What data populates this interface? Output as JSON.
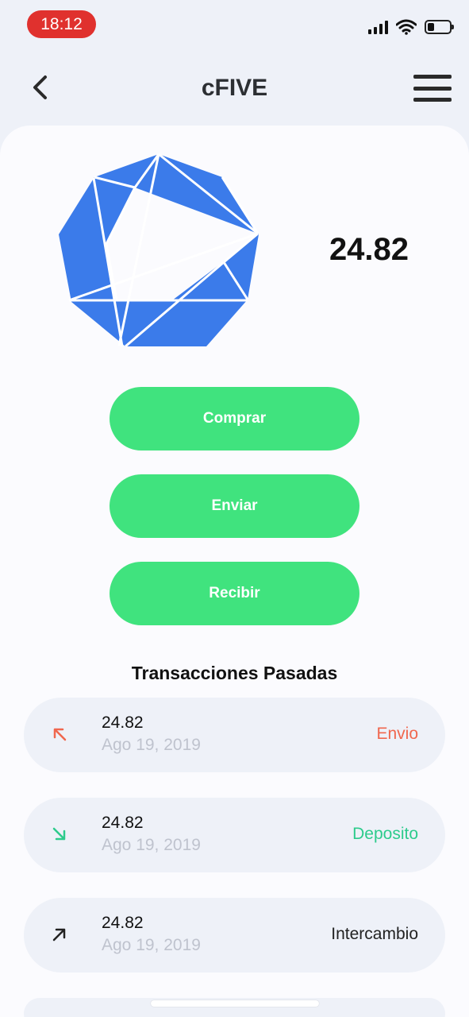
{
  "status_bar": {
    "time": "18:12",
    "time_color": "#E0312E",
    "icons": [
      "signal-icon",
      "wifi-icon",
      "battery-icon"
    ]
  },
  "nav": {
    "title": "cFIVE",
    "back_icon": "chevron-left-icon",
    "menu_icon": "hamburger-menu-icon"
  },
  "coin": {
    "logo_icon": "cfive-logo-icon",
    "logo_color": "#3B7BEA",
    "balance": "24.82"
  },
  "actions": {
    "buy_label": "Comprar",
    "send_label": "Enviar",
    "receive_label": "Recibir",
    "button_color": "#40E37E"
  },
  "transactions": {
    "title": "Transacciones Pasadas",
    "items": [
      {
        "amount": "24.82",
        "date": "Ago 19, 2019",
        "type": "Envio",
        "icon": "arrow-up-left-icon",
        "color": "#F0674E"
      },
      {
        "amount": "24.82",
        "date": "Ago 19, 2019",
        "type": "Deposito",
        "icon": "arrow-down-right-icon",
        "color": "#2DCB8C"
      },
      {
        "amount": "24.82",
        "date": "Ago 19, 2019",
        "type": "Intercambio",
        "icon": "arrow-up-right-icon",
        "color": "#222222"
      }
    ]
  }
}
